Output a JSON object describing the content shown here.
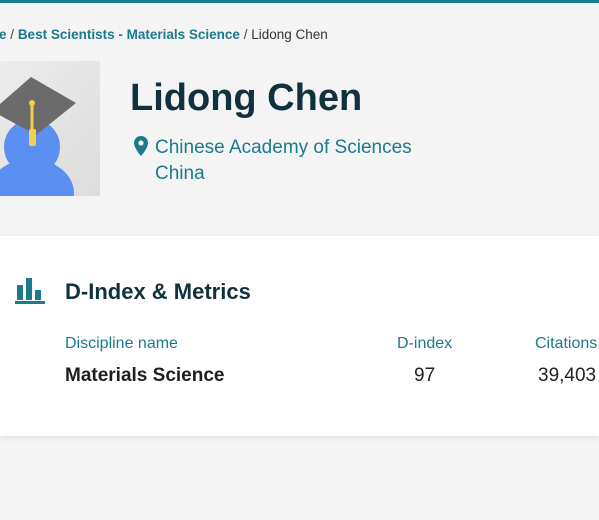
{
  "breadcrumb": {
    "home_partial": "e",
    "separator": "/",
    "category": "Best Scientists - Materials Science",
    "current": "Lidong Chen"
  },
  "profile": {
    "avatar_icon": "graduate-avatar-icon",
    "name": "Lidong Chen",
    "location_icon": "map-pin-icon",
    "institution": "Chinese Academy of Sciences",
    "country": "China"
  },
  "metrics": {
    "icon": "bar-chart-icon",
    "title": "D-Index & Metrics",
    "columns": [
      "Discipline name",
      "D-index",
      "Citations"
    ],
    "rows": [
      {
        "discipline": "Materials Science",
        "d_index": "97",
        "citations": "39,403"
      }
    ]
  },
  "colors": {
    "accent": "#1b7a8c",
    "heading": "#11313e",
    "background": "#f4f4f4",
    "card": "#ffffff",
    "avatar_blue": "#5b8ff2",
    "cap": "#6b6b6b",
    "tassel": "#f2d14a"
  }
}
